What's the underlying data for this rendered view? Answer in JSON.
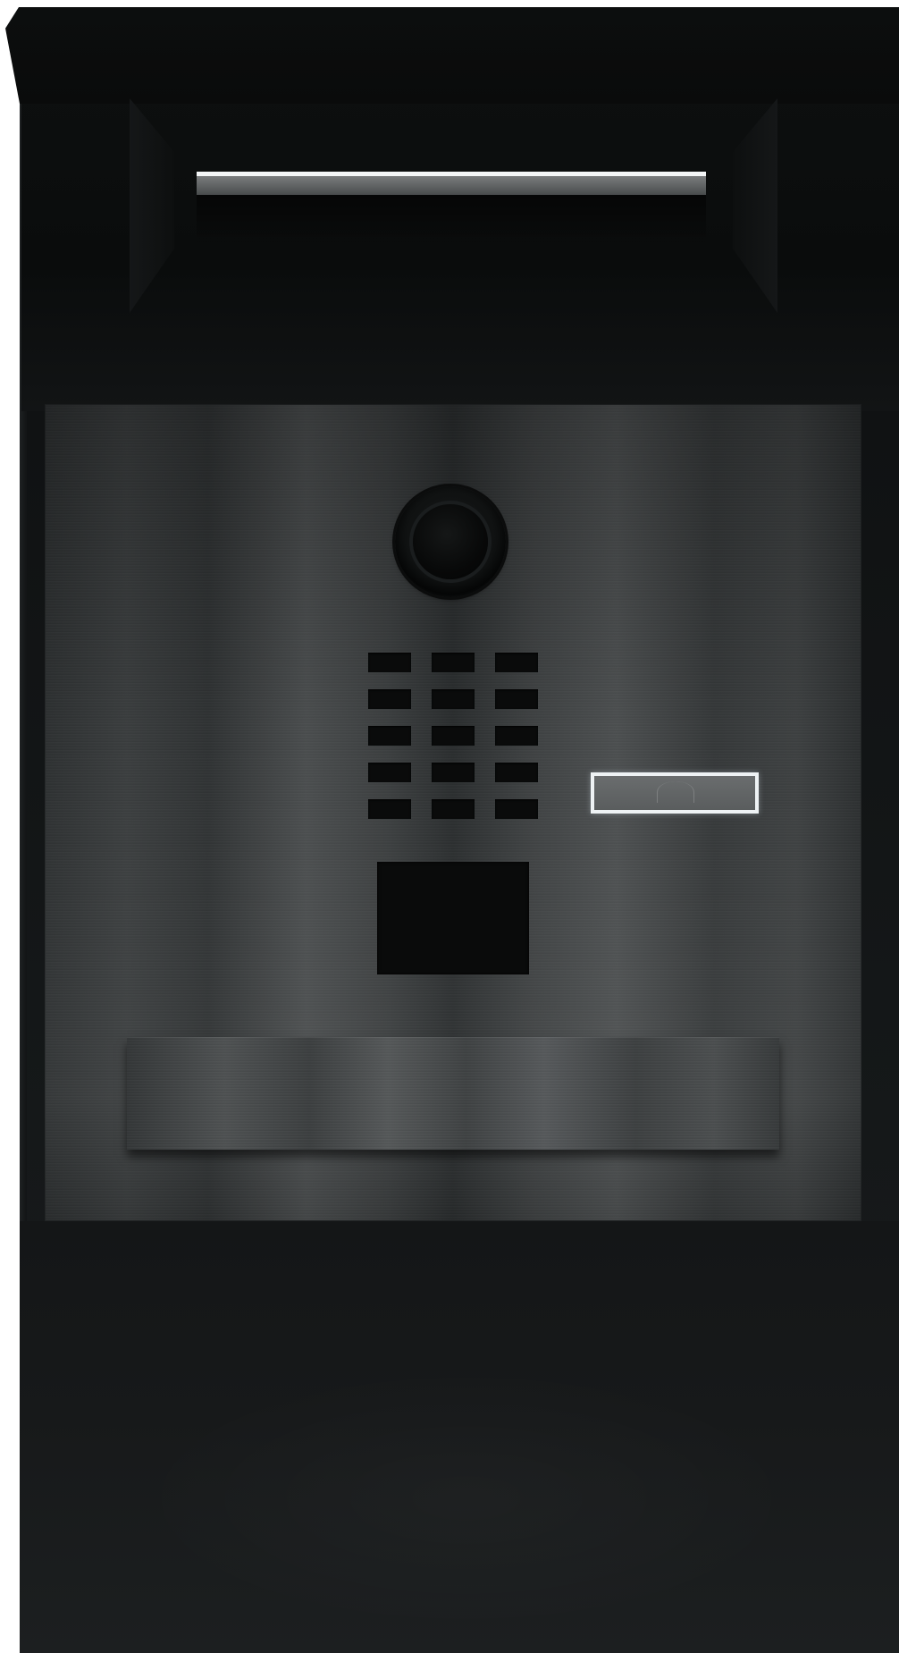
{
  "scene": {
    "subject": "",
    "colors": {
      "body": "#121415",
      "plate": "#3a3d3e",
      "button_outline": "#eef2f4",
      "slot_highlight": "#f4f6f7"
    },
    "icons": [
      "camera-icon",
      "speaker-grille-icon",
      "call-button-icon"
    ]
  }
}
